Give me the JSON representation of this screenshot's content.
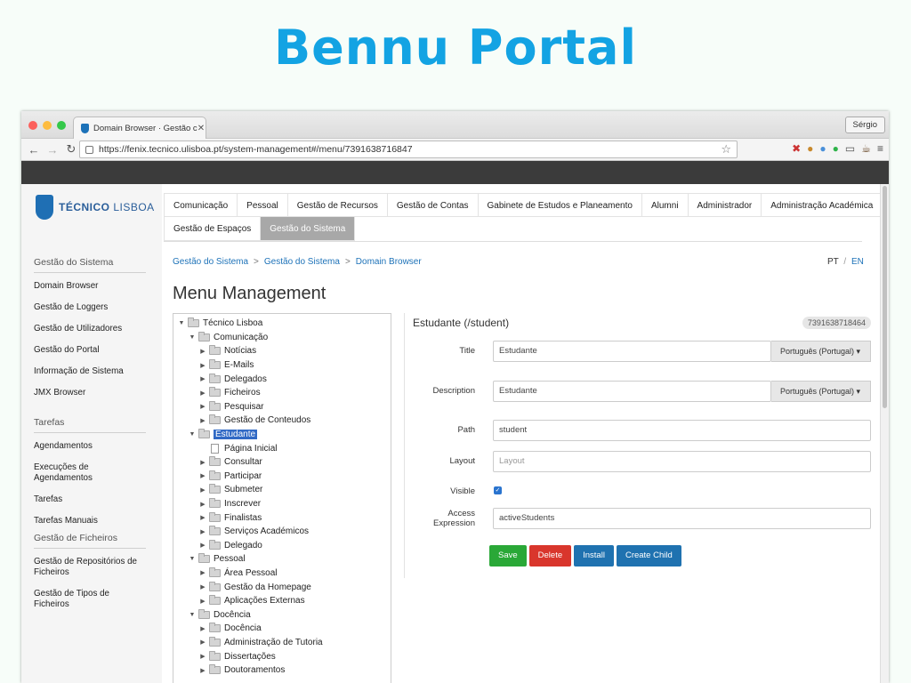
{
  "slide_title": "Bennu Portal",
  "browser": {
    "tab_title": "Domain Browser · Gestão c",
    "tab_close": "✕",
    "user": "Sérgio",
    "url": "https://fenix.tecnico.ulisboa.pt/system-management#/menu/7391638716847"
  },
  "logo": {
    "bold": "TÉCNICO",
    "light": " LISBOA"
  },
  "sidebar": [
    {
      "heading": "Gestão do Sistema",
      "items": [
        "Domain Browser",
        "Gestão de Loggers",
        "Gestão de Utilizadores",
        "Gestão do Portal",
        "Informação de Sistema",
        "JMX Browser"
      ]
    },
    {
      "heading": "Tarefas",
      "items": [
        "Agendamentos",
        "Execuções de Agendamentos",
        "Tarefas",
        "Tarefas Manuais"
      ]
    },
    {
      "heading": "Gestão de Ficheiros",
      "items": [
        "Gestão de Repositórios de Ficheiros",
        "Gestão de Tipos de Ficheiros"
      ]
    }
  ],
  "topnav": {
    "row1": [
      "Comunicação",
      "Pessoal",
      "Gestão de Recursos",
      "Gestão de Contas",
      "Gabinete de Estudos e Planeamento",
      "Alumni",
      "Administrador",
      "Administração Académica"
    ],
    "row2": [
      "Gestão de Espaços",
      "Gestão do Sistema"
    ],
    "active": "Gestão do Sistema"
  },
  "breadcrumb": [
    "Gestão do Sistema",
    "Gestão do Sistema",
    "Domain Browser"
  ],
  "breadcrumb_sep": ">",
  "lang": {
    "pt": "PT",
    "sep": "/",
    "en": "EN"
  },
  "page_title": "Menu Management",
  "tree": [
    {
      "label": "Técnico Lisboa",
      "level": 0,
      "toggle": "open",
      "kind": "folder"
    },
    {
      "label": "Comunicação",
      "level": 1,
      "toggle": "open",
      "kind": "folder"
    },
    {
      "label": "Notícias",
      "level": 2,
      "toggle": "closed",
      "kind": "folder"
    },
    {
      "label": "E-Mails",
      "level": 2,
      "toggle": "closed",
      "kind": "folder"
    },
    {
      "label": "Delegados",
      "level": 2,
      "toggle": "closed",
      "kind": "folder"
    },
    {
      "label": "Ficheiros",
      "level": 2,
      "toggle": "closed",
      "kind": "folder"
    },
    {
      "label": "Pesquisar",
      "level": 2,
      "toggle": "closed",
      "kind": "folder"
    },
    {
      "label": "Gestão de Conteudos",
      "level": 2,
      "toggle": "closed",
      "kind": "folder"
    },
    {
      "label": "Estudante",
      "level": 1,
      "toggle": "open",
      "kind": "folder",
      "selected": true
    },
    {
      "label": "Página Inicial",
      "level": 2,
      "toggle": "none",
      "kind": "file"
    },
    {
      "label": "Consultar",
      "level": 2,
      "toggle": "closed",
      "kind": "folder"
    },
    {
      "label": "Participar",
      "level": 2,
      "toggle": "closed",
      "kind": "folder"
    },
    {
      "label": "Submeter",
      "level": 2,
      "toggle": "closed",
      "kind": "folder"
    },
    {
      "label": "Inscrever",
      "level": 2,
      "toggle": "closed",
      "kind": "folder"
    },
    {
      "label": "Finalistas",
      "level": 2,
      "toggle": "closed",
      "kind": "folder"
    },
    {
      "label": "Serviços Académicos",
      "level": 2,
      "toggle": "closed",
      "kind": "folder"
    },
    {
      "label": "Delegado",
      "level": 2,
      "toggle": "closed",
      "kind": "folder"
    },
    {
      "label": "Pessoal",
      "level": 1,
      "toggle": "open",
      "kind": "folder"
    },
    {
      "label": "Área Pessoal",
      "level": 2,
      "toggle": "closed",
      "kind": "folder"
    },
    {
      "label": "Gestão da Homepage",
      "level": 2,
      "toggle": "closed",
      "kind": "folder"
    },
    {
      "label": "Aplicações Externas",
      "level": 2,
      "toggle": "closed",
      "kind": "folder"
    },
    {
      "label": "Docência",
      "level": 1,
      "toggle": "open",
      "kind": "folder"
    },
    {
      "label": "Docência",
      "level": 2,
      "toggle": "closed",
      "kind": "folder"
    },
    {
      "label": "Administração de Tutoria",
      "level": 2,
      "toggle": "closed",
      "kind": "folder"
    },
    {
      "label": "Dissertações",
      "level": 2,
      "toggle": "closed",
      "kind": "folder"
    },
    {
      "label": "Doutoramentos",
      "level": 2,
      "toggle": "closed",
      "kind": "folder"
    }
  ],
  "detail": {
    "title": "Estudante (/student)",
    "oid": "7391638718464",
    "title_label": "Title",
    "title_value": "Estudante",
    "title_lang": "Português (Portugal) ▾",
    "description_label": "Description",
    "description_value": "Estudante",
    "description_lang": "Português (Portugal) ▾",
    "path_label": "Path",
    "path_value": "student",
    "layout_label": "Layout",
    "layout_placeholder": "Layout",
    "visible_label": "Visible",
    "visible_checked": true,
    "access_label": "Access Expression",
    "access_value": "activeStudents",
    "buttons": [
      {
        "label": "Save",
        "color": "#2aa837"
      },
      {
        "label": "Delete",
        "color": "#d9362c"
      },
      {
        "label": "Install",
        "color": "#1f72b0"
      },
      {
        "label": "Create Child",
        "color": "#1f72b0"
      }
    ]
  }
}
